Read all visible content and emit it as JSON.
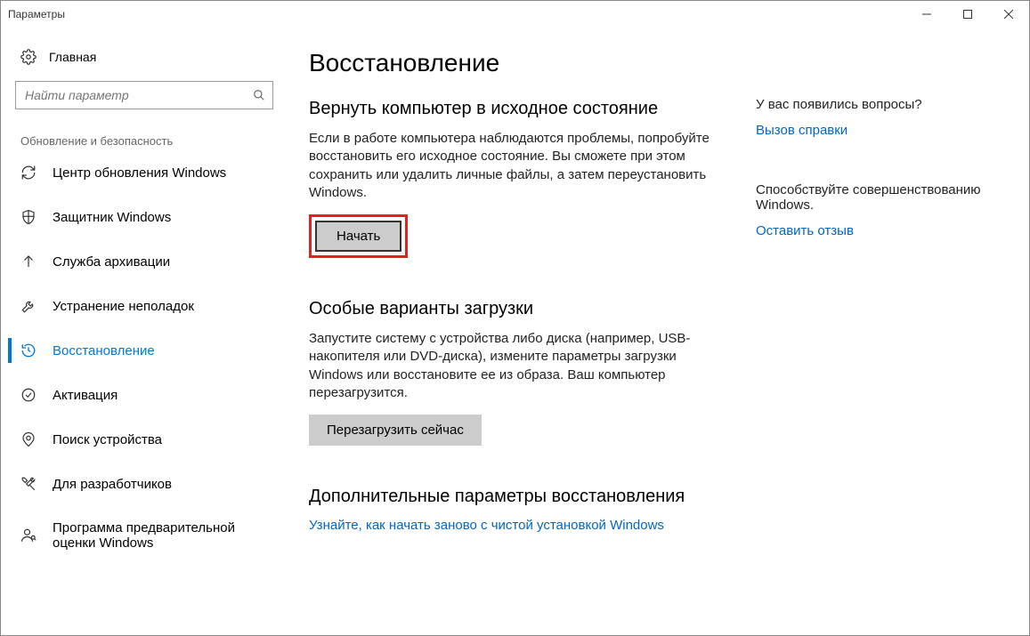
{
  "window": {
    "title": "Параметры"
  },
  "sidebar": {
    "home": "Главная",
    "search_placeholder": "Найти параметр",
    "section": "Обновление и безопасность",
    "items": [
      {
        "label": "Центр обновления Windows"
      },
      {
        "label": "Защитник Windows"
      },
      {
        "label": "Служба архивации"
      },
      {
        "label": "Устранение неполадок"
      },
      {
        "label": "Восстановление"
      },
      {
        "label": "Активация"
      },
      {
        "label": "Поиск устройства"
      },
      {
        "label": "Для разработчиков"
      },
      {
        "label": "Программа предварительной оценки Windows"
      }
    ]
  },
  "main": {
    "title": "Восстановление",
    "reset": {
      "heading": "Вернуть компьютер в исходное состояние",
      "text": "Если в работе компьютера наблюдаются проблемы, попробуйте восстановить его исходное состояние. Вы сможете при этом сохранить или удалить личные файлы, а затем переустановить Windows.",
      "button": "Начать"
    },
    "advanced": {
      "heading": "Особые варианты загрузки",
      "text": "Запустите систему с устройства либо диска (например, USB-накопителя или DVD-диска), измените параметры загрузки Windows или восстановите ее из образа. Ваш компьютер перезагрузится.",
      "button": "Перезагрузить сейчас"
    },
    "more": {
      "heading": "Дополнительные параметры восстановления",
      "link": "Узнайте, как начать заново с чистой установкой Windows"
    }
  },
  "right": {
    "help": {
      "heading": "У вас появились вопросы?",
      "link": "Вызов справки"
    },
    "feedback": {
      "heading": "Способствуйте совершенствованию Windows.",
      "link": "Оставить отзыв"
    }
  }
}
